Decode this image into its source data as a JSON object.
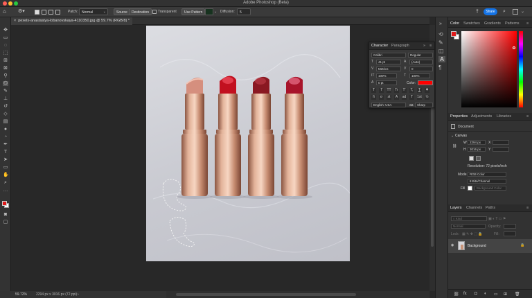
{
  "app": {
    "title": "Adobe Photoshop (Beta)",
    "share_label": "Share"
  },
  "options": {
    "patch_label": "Patch:",
    "patch_value": "Normal",
    "source_label": "Source",
    "destination_label": "Destination",
    "transparent_label": "Transparent",
    "use_pattern_label": "Use Pattern",
    "diffusion_label": "Diffusion:",
    "diffusion_value": "5"
  },
  "document": {
    "tab_label": "pexels-anastasiya-lobanovskaya-4110350.jpg @ 59.7% (RGB/8) *"
  },
  "status": {
    "zoom": "59.72%",
    "dims": "2294 px x 3016 px (72 ppi)"
  },
  "character": {
    "tabs": [
      "Character",
      "Paragraph"
    ],
    "font_family": "Calibri",
    "font_style": "Regular",
    "font_size": "41 pt",
    "leading": "(Auto)",
    "kerning": "Metrics",
    "tracking": "0",
    "vscale": "100%",
    "hscale": "100%",
    "baseline": "0 pt",
    "color_label": "Color:",
    "text_color": "#ff0000",
    "language": "English: USA",
    "aa_label": "aa",
    "antialias": "Sharp",
    "type_buttons": [
      "T",
      "T",
      "TT",
      "Tr",
      "T'",
      "T,",
      "T",
      "T"
    ],
    "ot_buttons": [
      "fi",
      "ơ",
      "st",
      "A",
      "ad",
      "T",
      "1st",
      "½"
    ]
  },
  "color_panel": {
    "tabs": [
      "Color",
      "Swatches",
      "Gradients",
      "Patterns"
    ],
    "fg": "#e01a1a"
  },
  "properties": {
    "tabs": [
      "Properties",
      "Adjustments",
      "Libraries"
    ],
    "kind_label": "Document",
    "canvas_label": "Canvas",
    "w_label": "W",
    "w_value": "2294 px",
    "h_label": "H",
    "h_value": "3016 px",
    "x_label": "X",
    "y_label": "Y",
    "resolution": "Resolution: 72 pixels/inch",
    "mode_label": "Mode",
    "mode_value": "RGB Color",
    "depth_value": "8 Bits/Channel",
    "fill_label": "Fill",
    "fill_value": "Background Color"
  },
  "layers": {
    "tabs": [
      "Layers",
      "Channels",
      "Paths"
    ],
    "kind_placeholder": "Kind",
    "blend_mode": "Normal",
    "opacity_label": "Opacity:",
    "lock_label": "Lock:",
    "fill_label": "Fill:",
    "items": [
      {
        "name": "Background"
      }
    ]
  },
  "colors": {
    "accent": "#1473e6",
    "lipstick_gold": "#c89479"
  }
}
